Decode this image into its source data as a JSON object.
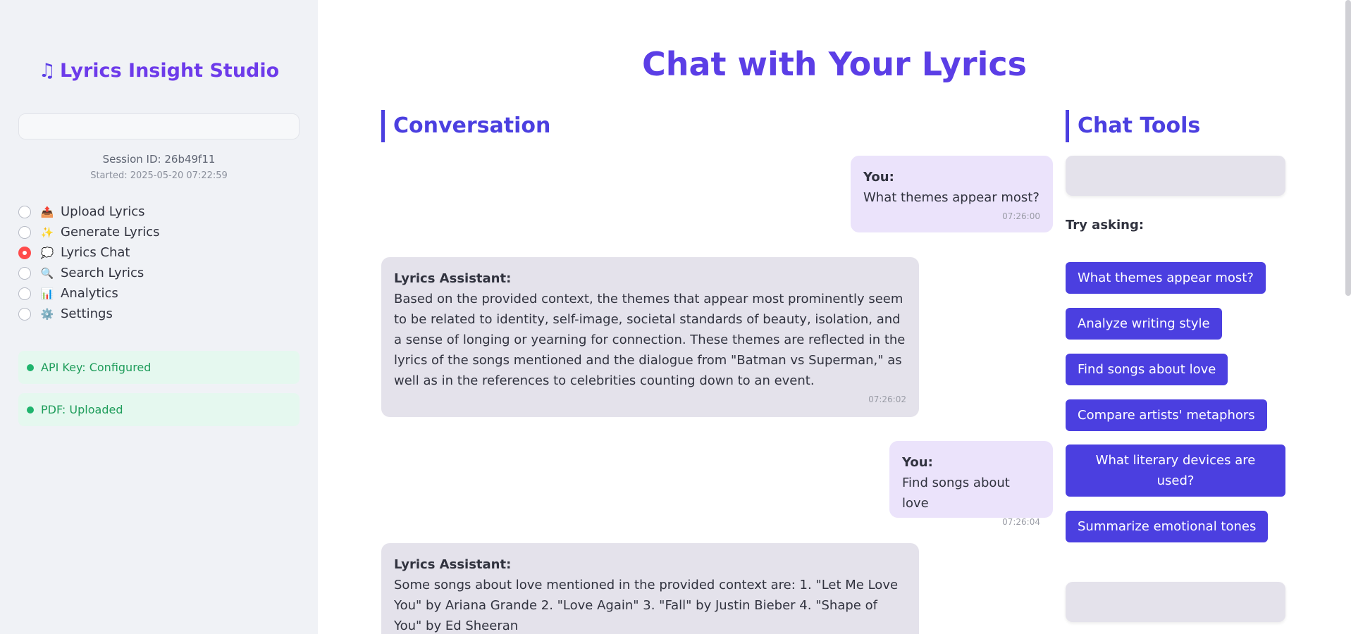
{
  "sidebar": {
    "brand": "Lyrics Insight Studio",
    "brand_icon": "music-note-icon",
    "session_id": "Session ID: 26b49f11",
    "session_started": "Started: 2025-05-20 07:22:59",
    "nav": [
      {
        "emoji": "📤",
        "label": "Upload Lyrics",
        "selected": false
      },
      {
        "emoji": "✨",
        "label": "Generate Lyrics",
        "selected": false
      },
      {
        "emoji": "💭",
        "label": "Lyrics Chat",
        "selected": true
      },
      {
        "emoji": "🔍",
        "label": "Search Lyrics",
        "selected": false
      },
      {
        "emoji": "📊",
        "label": "Analytics",
        "selected": false
      },
      {
        "emoji": "⚙️",
        "label": "Settings",
        "selected": false
      }
    ],
    "status": [
      {
        "text": "API Key: Configured"
      },
      {
        "text": "PDF: Uploaded"
      }
    ]
  },
  "main": {
    "title": "Chat with Your Lyrics",
    "conversation_title": "Conversation",
    "tools_title": "Chat Tools",
    "messages": [
      {
        "role": "user",
        "who": "You:",
        "text": "What themes appear most?",
        "time": "07:26:00"
      },
      {
        "role": "bot",
        "who": "Lyrics Assistant:",
        "text": "Based on the provided context, the themes that appear most prominently seem to be related to identity, self-image, societal standards of beauty, isolation, and a sense of longing or yearning for connection. These themes are reflected in the lyrics of the songs mentioned and the dialogue from \"Batman vs Superman,\" as well as in the references to celebrities counting down to an event.",
        "time": "07:26:02"
      },
      {
        "role": "user",
        "who": "You:",
        "text": "Find songs about love",
        "time": "07:26:04"
      },
      {
        "role": "bot",
        "who": "Lyrics Assistant:",
        "text": "Some songs about love mentioned in the provided context are: 1. \"Let Me Love You\" by Ariana Grande 2. \"Love Again\" 3. \"Fall\" by Justin Bieber 4. \"Shape of You\" by Ed Sheeran",
        "time": ""
      }
    ],
    "try_asking": "Try asking:",
    "suggestions": [
      "What themes appear most?",
      "Analyze writing style",
      "Find songs about love",
      "Compare artists' metaphors",
      "What literary devices are used?",
      "Summarize emotional tones"
    ]
  },
  "colors": {
    "accent": "#4b3fe0",
    "brand": "#6d3bea",
    "radio_selected": "#ff4b4b",
    "status_green": "#1f9d5b"
  }
}
